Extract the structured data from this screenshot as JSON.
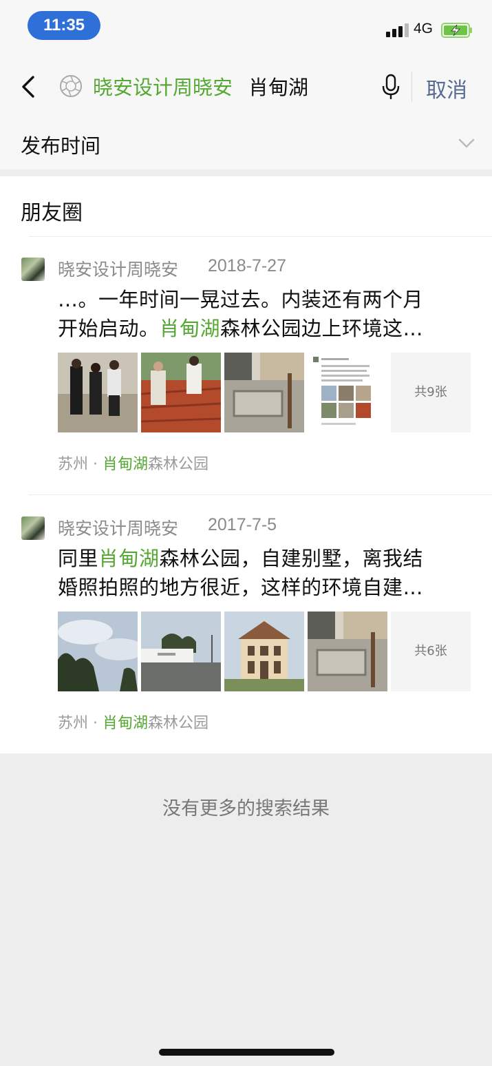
{
  "status_bar": {
    "time": "11:35",
    "network": "4G"
  },
  "search": {
    "author_tag": "晓安设计周晓安",
    "query": "肖甸湖",
    "cancel_label": "取消"
  },
  "filter": {
    "label": "发布时间"
  },
  "section": {
    "title": "朋友圈"
  },
  "posts": [
    {
      "author": "晓安设计周晓安",
      "date": "2018-7-27",
      "line1": "…。一年时间一晃过去。内装还有两个月",
      "line2_pre": "开始启动。",
      "line2_hl": "肖甸湖",
      "line2_post": "森林公园边上环境这…",
      "more_images": "共9张",
      "location_city": "苏州 · ",
      "location_hl": "肖甸湖",
      "location_post": "森林公园"
    },
    {
      "author": "晓安设计周晓安",
      "date": "2017-7-5",
      "line1_pre": "同里",
      "line1_hl": "肖甸湖",
      "line1_post": "森林公园，自建别墅，离我结",
      "line2": "婚照拍照的地方很近，这样的环境自建…",
      "more_images": "共6张",
      "location_city": "苏州 · ",
      "location_hl": "肖甸湖",
      "location_post": "森林公园"
    }
  ],
  "footer": {
    "no_more": "没有更多的搜索结果"
  },
  "colors": {
    "highlight": "#55a933",
    "link": "#576b95",
    "time_pill": "#2f6fd8"
  }
}
